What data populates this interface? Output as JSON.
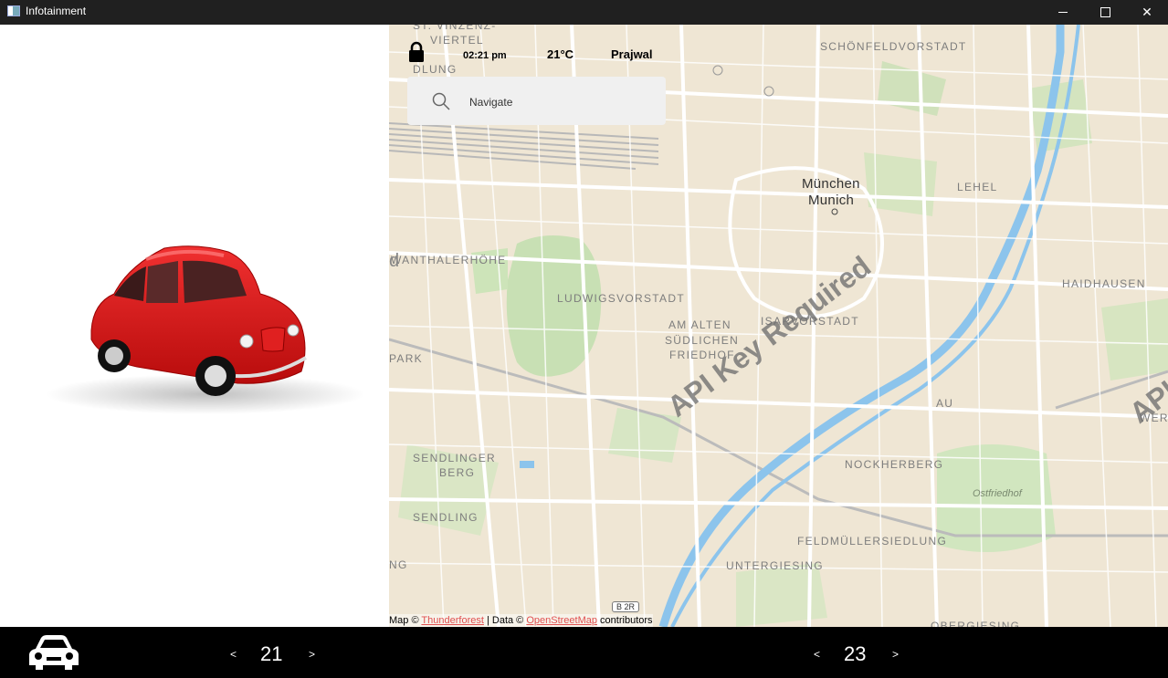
{
  "window": {
    "title": "Infotainment"
  },
  "status": {
    "time": "02:21 pm",
    "temperature": "21°C",
    "user": "Prajwal"
  },
  "search": {
    "placeholder": "Navigate"
  },
  "map": {
    "labels": {
      "st_vinzenz": "ST. VINZENZ-",
      "viertel": "VIERTEL",
      "dlung": "DLUNG",
      "schoenfeld": "SCHÖNFELDVORSTADT",
      "muenchen": "München",
      "munich": "Munich",
      "lehel": "LEHEL",
      "wanthalerhoehe": "WANTHALERHÖHE",
      "haidhausen": "HAIDHAUSEN",
      "ludwigsvorstadt": "LUDWIGSVORSTADT",
      "isarvorstadt": "ISARVORSTADT",
      "am_alten": "AM ALTEN",
      "suedlichen": "SÜDLICHEN",
      "friedhof": "FRIEDHOF",
      "park": "PARK",
      "au": "AU",
      "sendlinger": "SENDLINGER",
      "berg": "BERG",
      "sendling": "SENDLING",
      "nockherberg": "NOCKHERBERG",
      "ostfriedhof": "Ostfriedhof",
      "feldmuellersiedlung": "FELDMÜLLERSIEDLUNG",
      "untergiesing": "UNTERGIESING",
      "werk": "WERK",
      "ng": "NG",
      "d": "d",
      "b2r": "B 2R",
      "obergiesing": "OBERGIESING"
    },
    "watermark": "API Key Required",
    "watermark_partial": "API",
    "attribution": {
      "prefix": "Map © ",
      "thunderforest": "Thunderforest",
      "middle": " | Data © ",
      "osm": "OpenStreetMap",
      "suffix": " contributors"
    }
  },
  "bottom": {
    "left": {
      "prev": "<",
      "value": "21",
      "next": ">"
    },
    "right": {
      "prev": "<",
      "value": "23",
      "next": ">"
    }
  },
  "colors": {
    "map_land": "#efe6d4",
    "park": "#c8e0b4",
    "river": "#8cc4ec",
    "road": "#ffffff",
    "accent_link": "#e05050"
  }
}
